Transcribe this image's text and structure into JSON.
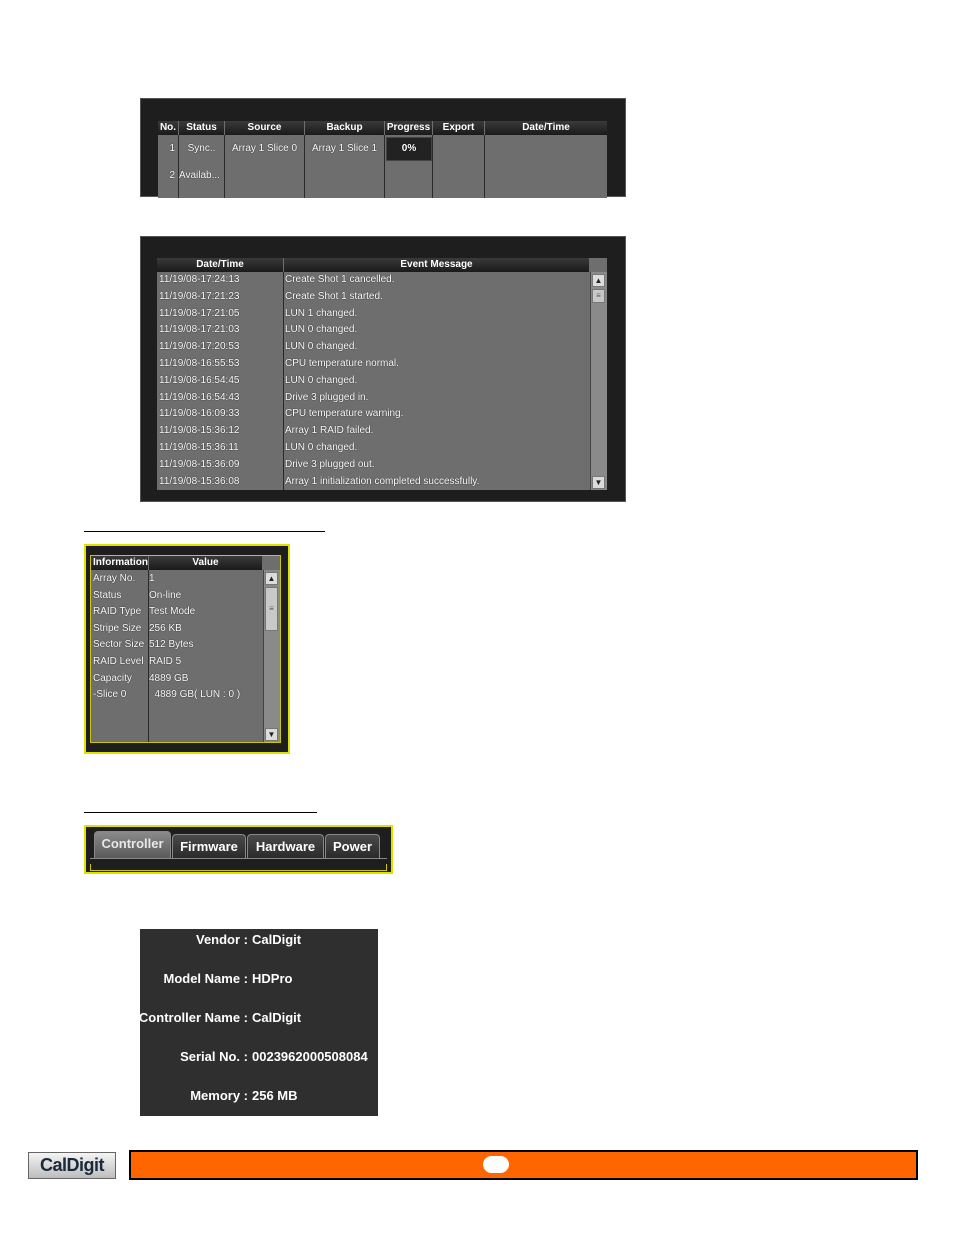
{
  "task_table": {
    "headers": [
      "No.",
      "Status",
      "Source",
      "Backup",
      "Progress",
      "Export",
      "Date/Time"
    ],
    "rows": [
      {
        "no": "1",
        "status": "Sync..",
        "source": "Array 1 Slice 0",
        "backup": "Array 1 Slice 1",
        "progress": "0%",
        "export": "",
        "datetime": ""
      },
      {
        "no": "2",
        "status": "Availab...",
        "source": "",
        "backup": "",
        "progress": "",
        "export": "",
        "datetime": ""
      }
    ]
  },
  "event_log": {
    "headers": [
      "Date/Time",
      "Event Message"
    ],
    "rows": [
      {
        "datetime": "11/19/08-17:24:13",
        "message": "Create Shot 1 cancelled."
      },
      {
        "datetime": "11/19/08-17:21:23",
        "message": "Create Shot 1 started."
      },
      {
        "datetime": "11/19/08-17:21:05",
        "message": "LUN 1 changed."
      },
      {
        "datetime": "11/19/08-17:21:03",
        "message": "LUN 0 changed."
      },
      {
        "datetime": "11/19/08-17:20:53",
        "message": "LUN 0 changed."
      },
      {
        "datetime": "11/19/08-16:55:53",
        "message": "CPU temperature normal."
      },
      {
        "datetime": "11/19/08-16:54:45",
        "message": "LUN 0 changed."
      },
      {
        "datetime": "11/19/08-16:54:43",
        "message": "Drive 3 plugged in."
      },
      {
        "datetime": "11/19/08-16:09:33",
        "message": "CPU temperature warning."
      },
      {
        "datetime": "11/19/08-15:36:12",
        "message": "Array 1 RAID failed."
      },
      {
        "datetime": "11/19/08-15:36:11",
        "message": "LUN 0 changed."
      },
      {
        "datetime": "11/19/08-15:36:09",
        "message": "Drive 3 plugged out."
      },
      {
        "datetime": "11/19/08-15:36:08",
        "message": "Array 1 initialization completed successfully."
      }
    ]
  },
  "array_info": {
    "headers": [
      "Information",
      "Value"
    ],
    "rows": [
      {
        "info": "Array No.",
        "value": "1"
      },
      {
        "info": "Status",
        "value": "On-line"
      },
      {
        "info": "RAID Type",
        "value": "Test Mode"
      },
      {
        "info": "Stripe Size",
        "value": "256 KB"
      },
      {
        "info": "Sector Size",
        "value": "512 Bytes"
      },
      {
        "info": "RAID Level",
        "value": "RAID 5"
      },
      {
        "info": "Capacity",
        "value": "4889 GB"
      },
      {
        "info": "-Slice 0",
        "value": "  4889 GB( LUN : 0 )"
      }
    ]
  },
  "tabs": [
    "Controller",
    "Firmware",
    "Hardware",
    "Power"
  ],
  "active_tab": "Controller",
  "controller_info": [
    {
      "label": "Vendor :",
      "value": "CalDigit"
    },
    {
      "label": "Model Name :",
      "value": "HDPro"
    },
    {
      "label": "Controller Name :",
      "value": "CalDigit"
    },
    {
      "label": "Serial No. :",
      "value": "0023962000508084"
    },
    {
      "label": "Memory :",
      "value": "256 MB"
    }
  ],
  "footer": {
    "logo_text": "CalDigit",
    "bar_color": "#ff6600"
  }
}
